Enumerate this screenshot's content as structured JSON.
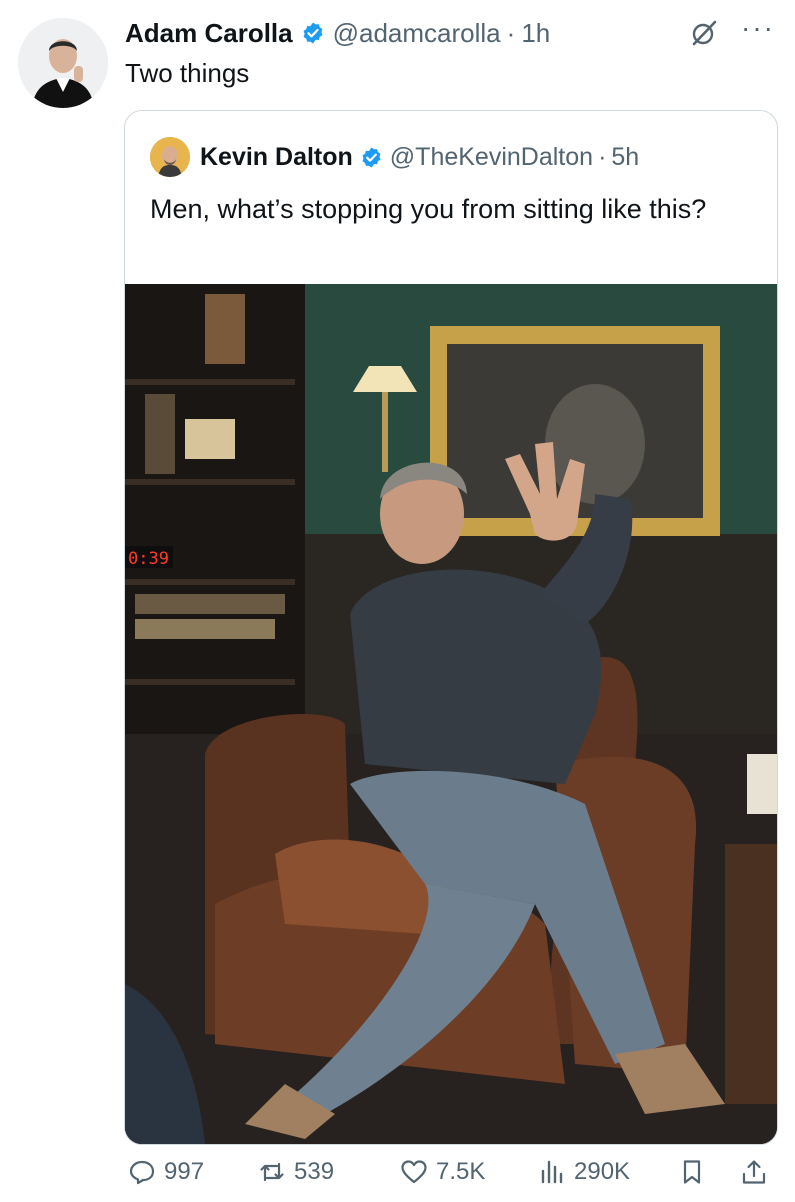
{
  "tweet": {
    "author_name": "Adam Carolla",
    "author_handle": "@adamcarolla",
    "separator": "·",
    "time": "1h",
    "text": "Two things"
  },
  "quoted_tweet": {
    "author_name": "Kevin Dalton",
    "author_handle": "@TheKevinDalton",
    "separator": "·",
    "time": "5h",
    "text": "Men, what’s stopping you from sitting like this?",
    "photo": {
      "clock_overlay": "0:39"
    }
  },
  "actions": {
    "replies": "997",
    "reposts": "539",
    "likes": "7.5K",
    "views": "290K"
  },
  "icons": {
    "verified": "verified-badge-icon",
    "grok": "grok-icon",
    "more": "more-icon",
    "reply": "reply-icon",
    "repost": "repost-icon",
    "like": "like-icon",
    "views": "views-icon",
    "bookmark": "bookmark-icon",
    "share": "share-icon"
  },
  "colors": {
    "verified": "#1d9bf0",
    "text": "#0f1419",
    "secondary": "#536471",
    "border": "#cfd9de"
  }
}
